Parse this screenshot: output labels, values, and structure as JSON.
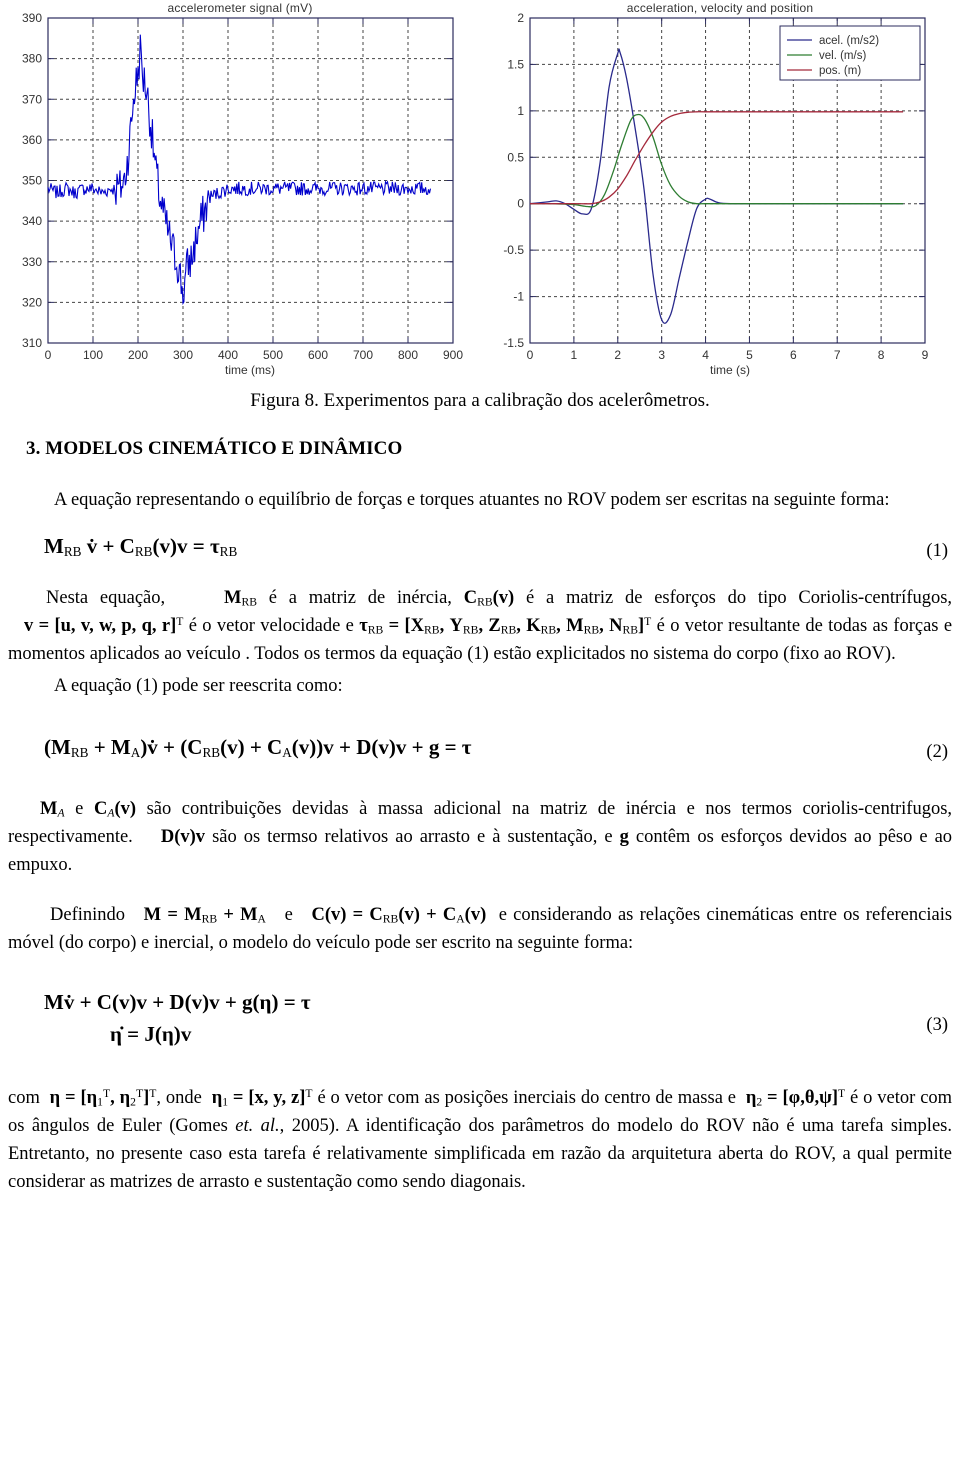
{
  "figure": {
    "caption": "Figura 8. Experimentos para a calibração dos acelerômetros."
  },
  "chart_data": [
    {
      "type": "line",
      "title": "accelerometer signal (mV)",
      "xlabel": "time (ms)",
      "ylabel": "",
      "xlim": [
        0,
        900
      ],
      "ylim": [
        310,
        390
      ],
      "xticks": [
        0,
        100,
        200,
        300,
        400,
        500,
        600,
        700,
        800,
        900
      ],
      "yticks": [
        310,
        320,
        330,
        340,
        350,
        360,
        370,
        380,
        390
      ],
      "grid": true,
      "legend": null,
      "series": [
        {
          "name": "accelerometer signal",
          "color": "#0000cc",
          "description": "noisy baseline near 348 mV, positive spike to ~382 mV near 205 ms, negative dip to ~319 mV near 300 ms, returning to ~348 mV baseline after ~360 ms, trace ends at ~850 ms",
          "x": [
            0,
            20,
            40,
            60,
            80,
            100,
            120,
            140,
            160,
            170,
            180,
            190,
            200,
            205,
            210,
            220,
            230,
            240,
            250,
            260,
            270,
            280,
            290,
            300,
            310,
            320,
            330,
            340,
            350,
            360,
            380,
            400,
            450,
            500,
            550,
            600,
            650,
            700,
            750,
            800,
            850
          ],
          "y": [
            348,
            347,
            348,
            347,
            348,
            348,
            347,
            348,
            348,
            350,
            358,
            370,
            377,
            382,
            376,
            372,
            362,
            352,
            345,
            340,
            336,
            332,
            329,
            322,
            329,
            331,
            336,
            340,
            343,
            346,
            347,
            348,
            348,
            348,
            348,
            348,
            348,
            348,
            348,
            348,
            348
          ]
        }
      ]
    },
    {
      "type": "line",
      "title": "acceleration, velocity and position",
      "xlabel": "time (s)",
      "ylabel": "",
      "xlim": [
        0,
        9
      ],
      "ylim": [
        -1.5,
        2
      ],
      "xticks": [
        0,
        1,
        2,
        3,
        4,
        5,
        6,
        7,
        8,
        9
      ],
      "yticks": [
        -1.5,
        -1,
        -0.5,
        0,
        0.5,
        1,
        1.5,
        2
      ],
      "grid": true,
      "legend_position": "top-right",
      "series": [
        {
          "name": "acel. (m/s2)",
          "color": "#2a2a8c",
          "x": [
            0,
            0.4,
            0.6,
            0.8,
            1.0,
            1.2,
            1.4,
            1.6,
            1.8,
            2.0,
            2.05,
            2.2,
            2.4,
            2.6,
            2.8,
            3.0,
            3.2,
            3.4,
            3.6,
            3.8,
            4.0,
            4.1,
            4.3,
            4.6,
            5.0,
            6.0,
            7.0,
            8.0,
            8.5
          ],
          "y": [
            0,
            0.02,
            0.03,
            0.0,
            -0.06,
            -0.11,
            -0.05,
            0.45,
            1.25,
            1.62,
            1.63,
            1.35,
            0.8,
            0.15,
            -0.75,
            -1.25,
            -1.2,
            -0.8,
            -0.4,
            -0.05,
            0.05,
            0.05,
            0.01,
            0,
            0,
            0,
            0,
            0,
            0
          ]
        },
        {
          "name": "vel. (m/s)",
          "color": "#2e7d32",
          "x": [
            0,
            0.5,
            1.0,
            1.3,
            1.5,
            1.7,
            1.9,
            2.1,
            2.3,
            2.45,
            2.6,
            2.8,
            3.0,
            3.2,
            3.4,
            3.6,
            3.8,
            4.0,
            4.5,
            5.0,
            6.0,
            7.0,
            8.0,
            8.5
          ],
          "y": [
            0,
            0,
            -0.01,
            -0.03,
            -0.02,
            0.1,
            0.35,
            0.65,
            0.9,
            0.96,
            0.92,
            0.72,
            0.42,
            0.2,
            0.08,
            0.02,
            0,
            0,
            0,
            0,
            0,
            0,
            0,
            0
          ]
        },
        {
          "name": "pos. (m)",
          "color": "#a52a3c",
          "x": [
            0,
            0.5,
            1.0,
            1.4,
            1.6,
            1.8,
            2.0,
            2.2,
            2.4,
            2.6,
            2.8,
            3.0,
            3.2,
            3.4,
            3.6,
            3.8,
            4.0,
            5.0,
            6.0,
            7.0,
            8.0,
            8.5
          ],
          "y": [
            0,
            0,
            0,
            0,
            0.02,
            0.07,
            0.16,
            0.3,
            0.47,
            0.63,
            0.77,
            0.88,
            0.94,
            0.97,
            0.985,
            0.99,
            0.99,
            0.99,
            0.99,
            0.99,
            0.99,
            0.99
          ]
        }
      ]
    }
  ],
  "document": {
    "section_heading": "3. MODELOS CINEMÁTICO E DINÂMICO",
    "para_1": "A equação representando o equilíbrio de forças e torques atuantes no ROV podem ser escritas na seguinte forma:",
    "eq1_number": "(1)",
    "eq2_number": "(2)",
    "eq3_number": "(3)",
    "para_2_a": "Nesta equação,",
    "para_2_b": "é a matriz de inércia,",
    "para_2_c": "é a matriz de esforços do tipo Coriolis-centrífugos,",
    "para_2_d": "é o vetor velocidade e",
    "para_2_e": "é o vetor resultante de todas as forças e momentos aplicados ao veículo .  Todos os termos da equação (1) estão explicitados no sistema do corpo (fixo ao ROV).",
    "para_3": "A equação (1) pode ser reescrita como:",
    "para_4_a": "e",
    "para_4_b": "são contribuições devidas à massa adicional na matriz de inércia e nos termos coriolis-centrifugos, respectivamente.",
    "para_4_c": "são os termso relativos ao arrasto e à sustentação, e",
    "para_4_d": "contêm os esforços devidos ao pêso e ao empuxo.",
    "para_5_a": "Definindo",
    "para_5_b": "e",
    "para_5_c": "e considerando as relações cinemáticas entre os referenciais móvel (do corpo) e inercial, o modelo do veículo pode ser escrito na seguinte forma:",
    "para_6_a": "com",
    "para_6_b": ",   onde",
    "para_6_c": "é o vetor com as posições inerciais do centro de massa e",
    "para_6_d": "é o vetor com os ângulos de Euler (Gomes",
    "para_6_e": "et. al.",
    "para_6_f": ", 2005). A identificação dos parâmetros do modelo do ROV não é uma tarefa simples. Entretanto, no presente caso esta tarefa é relativamente simplificada em razão da arquitetura aberta do ROV, a qual permite considerar as matrizes de arrasto e sustentação como sendo diagonais."
  }
}
